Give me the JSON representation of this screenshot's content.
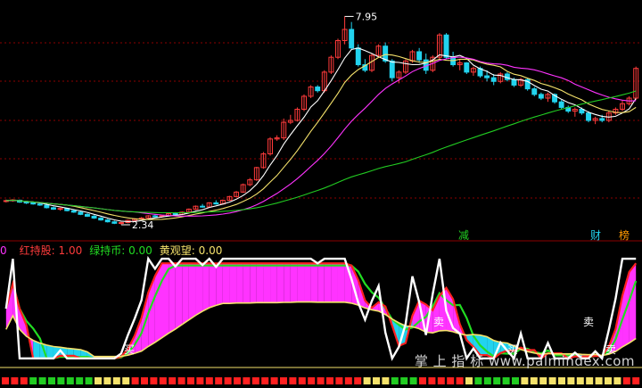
{
  "colors": {
    "background": "#000000",
    "up": "#ff3b3b",
    "down": "#22d3ee",
    "ma_white": "#ffffff",
    "ma_yellow": "#f5e26b",
    "ma_magenta": "#ff33ff",
    "ma_green": "#22cc22",
    "grid": "#8b0000",
    "fill_magenta": "#ff33ff",
    "fill_cyan": "#22d3ee",
    "line_red": "#ff2020",
    "line_green": "#22dd22",
    "line_yellow": "#f5e26b",
    "bar_red": "#ff2020",
    "bar_green": "#22cc22",
    "bar_yellow": "#f5e26b"
  },
  "price_chart": {
    "high_label": "7.95",
    "low_label": "2.34",
    "tags": [
      {
        "text": "减",
        "color": "#22cc22"
      },
      {
        "text": "财",
        "color": "#22d3ee"
      },
      {
        "text": "榜",
        "color": "#ff9900"
      }
    ]
  },
  "indicator": {
    "legend": [
      {
        "text": "0",
        "color": "#ff33ff"
      },
      {
        "text": "红持股: 1.00",
        "color": "#ff3b3b"
      },
      {
        "text": "绿持币: 0.00",
        "color": "#22dd22"
      },
      {
        "text": "黄观望: 0.00",
        "color": "#f5e26b"
      }
    ],
    "signals": [
      "买",
      "卖",
      "买",
      "卖",
      "卖"
    ],
    "watermark": "掌 上 指 标 www.palmindex.com"
  },
  "chart_data": {
    "type": "candlestick",
    "ylim": [
      2.1,
      8.2
    ],
    "candles": [
      [
        2.97,
        3.02,
        2.94,
        2.99
      ],
      [
        2.99,
        3.03,
        2.96,
        3.01
      ],
      [
        3.0,
        3.02,
        2.93,
        2.95
      ],
      [
        2.95,
        2.98,
        2.9,
        2.93
      ],
      [
        2.93,
        2.96,
        2.88,
        2.9
      ],
      [
        2.9,
        2.93,
        2.85,
        2.87
      ],
      [
        2.87,
        2.9,
        2.78,
        2.8
      ],
      [
        2.8,
        2.83,
        2.74,
        2.76
      ],
      [
        2.76,
        2.8,
        2.72,
        2.78
      ],
      [
        2.78,
        2.8,
        2.7,
        2.72
      ],
      [
        2.72,
        2.75,
        2.66,
        2.68
      ],
      [
        2.68,
        2.71,
        2.6,
        2.62
      ],
      [
        2.62,
        2.65,
        2.55,
        2.57
      ],
      [
        2.57,
        2.6,
        2.5,
        2.52
      ],
      [
        2.52,
        2.55,
        2.45,
        2.47
      ],
      [
        2.47,
        2.5,
        2.4,
        2.42
      ],
      [
        2.42,
        2.45,
        2.36,
        2.38
      ],
      [
        2.38,
        2.42,
        2.34,
        2.4
      ],
      [
        2.4,
        2.48,
        2.38,
        2.46
      ],
      [
        2.46,
        2.52,
        2.43,
        2.5
      ],
      [
        2.5,
        2.55,
        2.47,
        2.52
      ],
      [
        2.52,
        2.6,
        2.5,
        2.58
      ],
      [
        2.58,
        2.62,
        2.54,
        2.56
      ],
      [
        2.56,
        2.6,
        2.53,
        2.58
      ],
      [
        2.58,
        2.66,
        2.56,
        2.64
      ],
      [
        2.64,
        2.68,
        2.6,
        2.62
      ],
      [
        2.62,
        2.7,
        2.6,
        2.68
      ],
      [
        2.68,
        2.78,
        2.66,
        2.76
      ],
      [
        2.76,
        2.86,
        2.74,
        2.84
      ],
      [
        2.84,
        2.9,
        2.8,
        2.82
      ],
      [
        2.82,
        2.95,
        2.8,
        2.93
      ],
      [
        2.93,
        3.0,
        2.88,
        2.9
      ],
      [
        2.9,
        3.02,
        2.88,
        3.0
      ],
      [
        3.0,
        3.12,
        2.98,
        3.1
      ],
      [
        3.1,
        3.25,
        3.08,
        3.22
      ],
      [
        3.22,
        3.45,
        3.2,
        3.42
      ],
      [
        3.42,
        3.6,
        3.38,
        3.55
      ],
      [
        3.55,
        3.9,
        3.52,
        3.88
      ],
      [
        3.88,
        4.3,
        3.85,
        4.25
      ],
      [
        4.25,
        4.7,
        4.2,
        4.65
      ],
      [
        4.65,
        4.75,
        4.6,
        4.68
      ],
      [
        4.68,
        5.2,
        4.62,
        5.1
      ],
      [
        5.1,
        5.3,
        5.05,
        5.15
      ],
      [
        5.15,
        5.5,
        5.12,
        5.45
      ],
      [
        5.45,
        5.85,
        5.4,
        5.8
      ],
      [
        5.8,
        6.1,
        5.75,
        6.05
      ],
      [
        6.05,
        6.1,
        5.9,
        5.95
      ],
      [
        5.95,
        6.5,
        5.9,
        6.45
      ],
      [
        6.45,
        6.9,
        6.4,
        6.85
      ],
      [
        6.85,
        7.35,
        6.8,
        7.3
      ],
      [
        7.3,
        7.95,
        7.2,
        7.6
      ],
      [
        7.6,
        7.8,
        7.05,
        7.1
      ],
      [
        7.1,
        7.2,
        6.6,
        6.65
      ],
      [
        6.65,
        6.8,
        6.45,
        6.5
      ],
      [
        6.5,
        6.95,
        6.45,
        6.9
      ],
      [
        6.9,
        7.2,
        6.85,
        7.15
      ],
      [
        7.15,
        7.25,
        6.7,
        6.75
      ],
      [
        6.75,
        6.8,
        6.2,
        6.3
      ],
      [
        6.3,
        6.5,
        6.15,
        6.45
      ],
      [
        6.45,
        6.8,
        6.4,
        6.75
      ],
      [
        6.75,
        7.05,
        6.7,
        7.0
      ],
      [
        7.0,
        7.1,
        6.7,
        6.78
      ],
      [
        6.78,
        6.95,
        6.4,
        6.5
      ],
      [
        6.5,
        6.9,
        6.45,
        6.85
      ],
      [
        6.85,
        7.5,
        6.8,
        7.45
      ],
      [
        7.45,
        7.5,
        6.8,
        6.85
      ],
      [
        6.85,
        7.0,
        6.6,
        6.65
      ],
      [
        6.65,
        6.8,
        6.5,
        6.7
      ],
      [
        6.7,
        6.72,
        6.4,
        6.45
      ],
      [
        6.45,
        6.6,
        6.35,
        6.55
      ],
      [
        6.55,
        6.6,
        6.3,
        6.35
      ],
      [
        6.35,
        6.5,
        6.2,
        6.3
      ],
      [
        6.3,
        6.4,
        6.1,
        6.2
      ],
      [
        6.2,
        6.45,
        6.15,
        6.4
      ],
      [
        6.4,
        6.45,
        6.2,
        6.25
      ],
      [
        6.25,
        6.3,
        6.05,
        6.1
      ],
      [
        6.1,
        6.3,
        6.05,
        6.25
      ],
      [
        6.25,
        6.3,
        5.95,
        6.0
      ],
      [
        6.0,
        6.05,
        5.8,
        5.85
      ],
      [
        5.85,
        5.9,
        5.7,
        5.75
      ],
      [
        5.75,
        5.9,
        5.65,
        5.85
      ],
      [
        5.85,
        5.88,
        5.6,
        5.65
      ],
      [
        5.65,
        5.7,
        5.45,
        5.5
      ],
      [
        5.5,
        5.55,
        5.35,
        5.4
      ],
      [
        5.4,
        5.5,
        5.25,
        5.45
      ],
      [
        5.45,
        5.5,
        5.3,
        5.35
      ],
      [
        5.35,
        5.4,
        5.1,
        5.15
      ],
      [
        5.15,
        5.25,
        5.05,
        5.2
      ],
      [
        5.2,
        5.3,
        5.1,
        5.15
      ],
      [
        5.15,
        5.4,
        5.1,
        5.35
      ],
      [
        5.35,
        5.5,
        5.3,
        5.45
      ],
      [
        5.45,
        5.7,
        5.4,
        5.6
      ],
      [
        5.6,
        5.8,
        5.55,
        5.75
      ],
      [
        5.75,
        6.6,
        5.7,
        6.55
      ]
    ]
  }
}
